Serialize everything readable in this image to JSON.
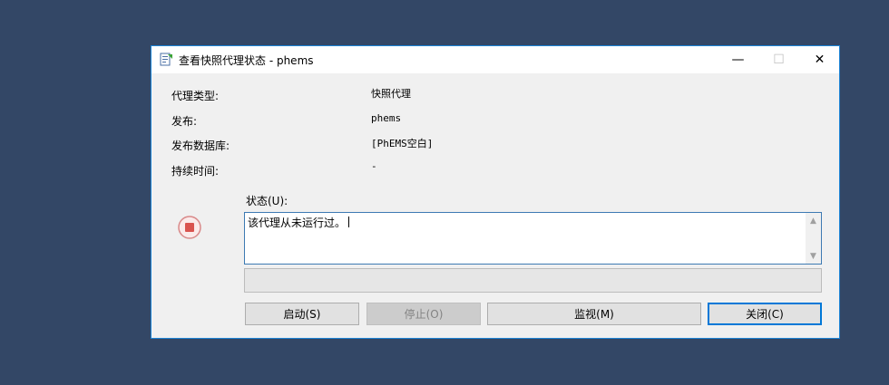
{
  "window": {
    "title": "查看快照代理状态 - phems",
    "minimize": "—",
    "maximize": "☐",
    "close": "✕"
  },
  "fields": [
    {
      "label": "代理类型:",
      "value": "快照代理"
    },
    {
      "label": "发布:",
      "value": "phems"
    },
    {
      "label": "发布数据库:",
      "value": "[PhEMS空白]"
    },
    {
      "label": "持续时间:",
      "value": "-"
    }
  ],
  "status": {
    "label": "状态(U):",
    "text": "该代理从未运行过。",
    "icon": "stop-icon"
  },
  "progress": {
    "fraction": 0
  },
  "buttons": {
    "start": "启动(S)",
    "stop": "停止(O)",
    "monitor": "监视(M)",
    "close": "关闭(C)"
  },
  "colors": {
    "desktop": "#334766",
    "accent": "#0078d7",
    "stop_red": "#d9534f"
  }
}
